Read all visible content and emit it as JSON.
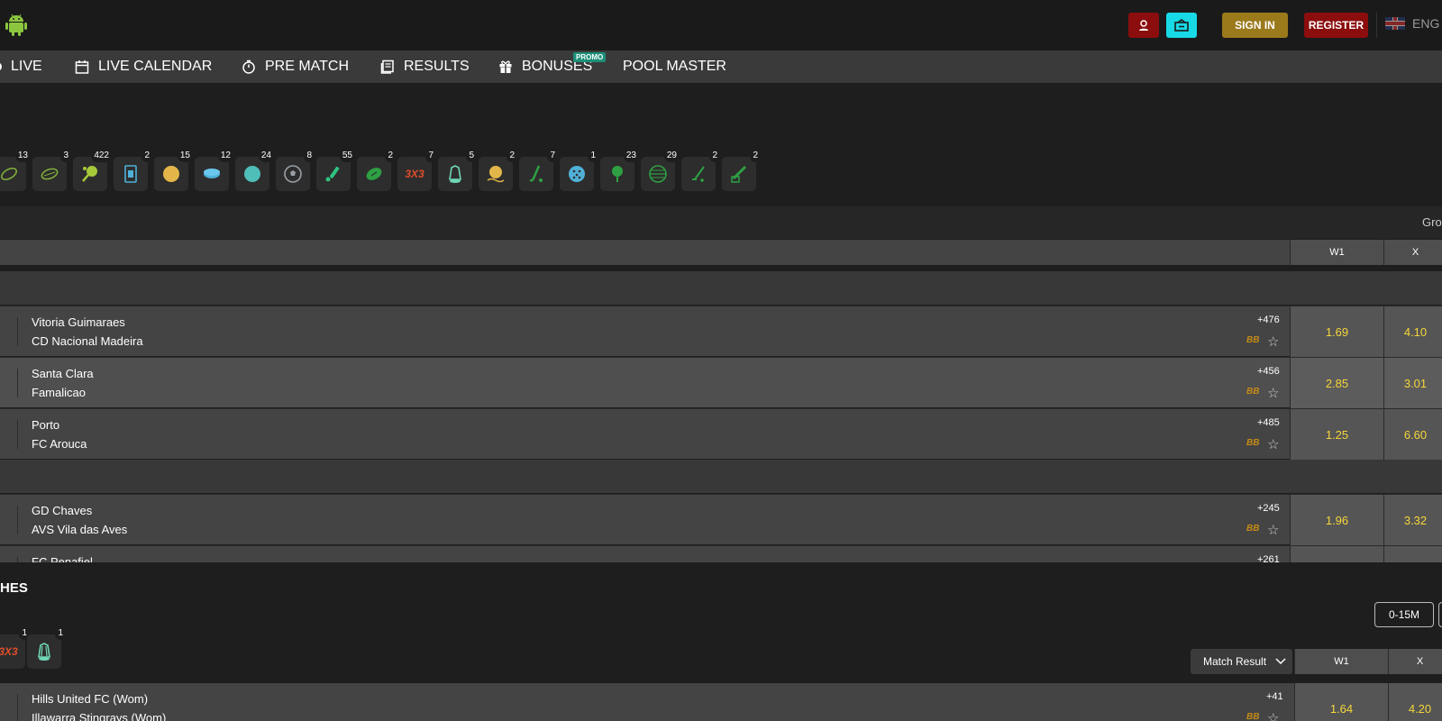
{
  "header": {
    "sign_in": "SIGN IN",
    "register": "REGISTER",
    "language": "ENG"
  },
  "nav": {
    "items": [
      {
        "label": "LIVE",
        "icon": "live-dot-icon"
      },
      {
        "label": "LIVE CALENDAR",
        "icon": "calendar-icon"
      },
      {
        "label": "PRE MATCH",
        "icon": "stopwatch-icon"
      },
      {
        "label": "RESULTS",
        "icon": "results-icon"
      },
      {
        "label": "BONUSES",
        "icon": "gift-icon"
      },
      {
        "label": "POOL MASTER",
        "icon": ""
      }
    ],
    "promo_tag": "PROMO"
  },
  "live_sports": [
    {
      "icon": "rugby-icon",
      "count": "13",
      "color": "#7fae3b"
    },
    {
      "icon": "aussie-rules-icon",
      "count": "3",
      "color": "#7fae3b"
    },
    {
      "icon": "table-tennis-icon",
      "count": "422",
      "color": "#a6c93a"
    },
    {
      "icon": "card-game-icon",
      "count": "2",
      "color": "#4fb1d8"
    },
    {
      "icon": "volleyball-icon",
      "count": "15",
      "color": "#e3b64a"
    },
    {
      "icon": "ice-hockey-icon",
      "count": "12",
      "color": "#4fb1d8"
    },
    {
      "icon": "tennis-icon",
      "count": "24",
      "color": "#4fbdb8"
    },
    {
      "icon": "football-icon",
      "count": "8",
      "color": "#9aa0a6"
    },
    {
      "icon": "cricket-icon",
      "count": "55",
      "color": "#2ec27e"
    },
    {
      "icon": "american-football-icon",
      "count": "2",
      "color": "#2ea043"
    },
    {
      "icon": "3x3-basketball-icon",
      "count": "7",
      "color": "#e04e2b"
    },
    {
      "icon": "badminton-icon",
      "count": "5",
      "color": "#6fd6b6"
    },
    {
      "icon": "beach-volleyball-icon",
      "count": "2",
      "color": "#e3b64a"
    },
    {
      "icon": "field-hockey-icon",
      "count": "7",
      "color": "#2ea043"
    },
    {
      "icon": "floorball-icon",
      "count": "1",
      "color": "#4fb1d8"
    },
    {
      "icon": "golf-icon",
      "count": "23",
      "color": "#2ea043"
    },
    {
      "icon": "lacrosse-ball-icon",
      "count": "29",
      "color": "#2ea043"
    },
    {
      "icon": "hockey-stick-icon",
      "count": "2",
      "color": "#2ea043"
    },
    {
      "icon": "baseball-bat-icon",
      "count": "2",
      "color": "#2ea043"
    }
  ],
  "live_table": {
    "group_label": "Gro",
    "columns": [
      "W1",
      "X"
    ],
    "matches": [
      {
        "team1": "Vitoria Guimaraes",
        "team2": "CD Nacional Madeira",
        "more": "+476",
        "bb": "BB",
        "w1": "1.69",
        "x": "4.10"
      },
      {
        "team1": "Santa Clara",
        "team2": "Famalicao",
        "more": "+456",
        "bb": "BB",
        "w1": "2.85",
        "x": "3.01"
      },
      {
        "team1": "Porto",
        "team2": "FC Arouca",
        "more": "+485",
        "bb": "BB",
        "w1": "1.25",
        "x": "6.60"
      },
      {
        "team1": "GD Chaves",
        "team2": "AVS Vila das Aves",
        "more": "+245",
        "bb": "BB",
        "w1": "1.96",
        "x": "3.32"
      },
      {
        "team1": "FC Penafiel",
        "team2": "",
        "more": "+261",
        "bb": "",
        "w1": "",
        "x": ""
      }
    ]
  },
  "prematch": {
    "title": "HES",
    "time_filter": "0-15M",
    "sports": [
      {
        "icon": "3x3-basketball-icon",
        "count": "1"
      },
      {
        "icon": "badminton-icon",
        "count": "1"
      }
    ],
    "market_select": "Match Result",
    "columns": [
      "W1",
      "X"
    ],
    "matches": [
      {
        "team1": "Hills United FC (Wom)",
        "team2": "Illawarra Stingrays (Wom)",
        "more": "+41",
        "bb": "BB",
        "w1": "1.64",
        "x": "4.20"
      }
    ]
  },
  "colors": {
    "odds": "#f5d63a",
    "sign_in_bg": "#9b7a1c",
    "register_bg": "#8b0d0d",
    "promo_btn_bg": "#18d9e6"
  }
}
